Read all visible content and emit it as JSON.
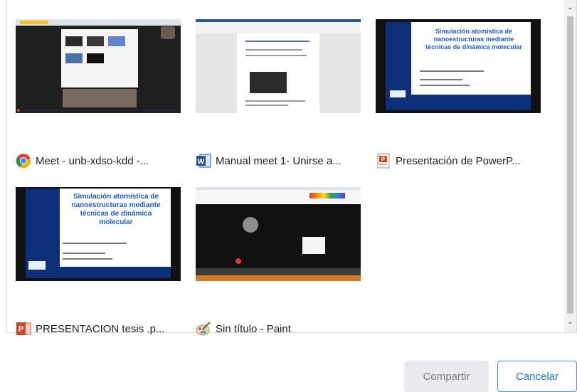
{
  "windows": [
    {
      "label": "Meet - unb-xdso-kdd -...",
      "icon": "chrome-icon",
      "thumbnail": "meet-tab"
    },
    {
      "label": "Manual meet 1- Unirse a...",
      "icon": "word-icon",
      "thumbnail": "word-doc"
    },
    {
      "label": "Presentación de PowerP...",
      "icon": "powerpoint-viewer-icon",
      "thumbnail": "slide"
    },
    {
      "label": "PRESENTACION tesis .p...",
      "icon": "powerpoint-icon",
      "thumbnail": "slide"
    },
    {
      "label": "Sin título - Paint",
      "icon": "paint-icon",
      "thumbnail": "paint"
    }
  ],
  "slide": {
    "title": "Simulación atomística de nanoestructuras mediante técnicas de dinámica molecular"
  },
  "buttons": {
    "share_label": "Compartir",
    "cancel_label": "Cancelar"
  },
  "scrollbar": {
    "up_glyph": "⌃",
    "down_glyph": "⌄"
  },
  "colors": {
    "accent": "#1a73e8",
    "disabled_bg": "#e8eaed",
    "slide_title": "#1e5bd6",
    "slide_sidebar": "#0d2e78"
  }
}
